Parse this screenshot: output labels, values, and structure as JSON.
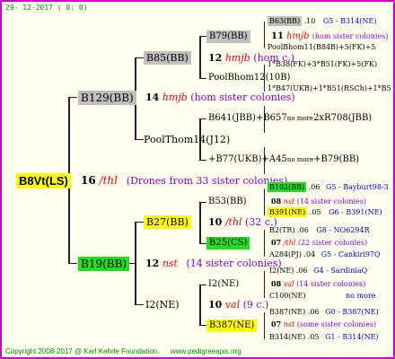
{
  "header": {
    "date": "29- 12-2017 (  0:  0)"
  },
  "footer": {
    "copyright": "Copyright 2008-2017 @ Karl Kehrle Foundation.",
    "site": "www.pedigreeapis.org"
  },
  "root": {
    "name": "B8Vt(LS)",
    "year": "16",
    "mark": "/thl",
    "info": "(Drones from 33 sister colonies)"
  },
  "gen2": {
    "upper": {
      "name": "B129(BB)",
      "year": "14",
      "mark": "hmjb",
      "info": "(hom sister colonies)"
    },
    "lower": {
      "name": "B19(BB)",
      "year": "12",
      "mark": "nst",
      "info": "(14 sister colonies)"
    }
  },
  "gen3": [
    {
      "name": "B85(BB)",
      "year": "12",
      "mark": "hmjb",
      "info": "(hom c.)"
    },
    {
      "name": "PoolThom14(J12)"
    },
    {
      "name": "B27(BB)",
      "year": "10",
      "mark": "/thl",
      "info": "(32 c.)"
    },
    {
      "name": "I2(NE)",
      "year": "10",
      "mark": "val",
      "info": "(9 c.)"
    }
  ],
  "gen4": [
    {
      "name": "B79(BB)",
      "year": "11",
      "mark": "hmjb",
      "info": "(hom sister colonies)"
    },
    {
      "name": "PoolBhom12(10B)"
    },
    {
      "name": "B641(JBB)+B657",
      "mid": "no more",
      "tail": "2xR708(JBB)"
    },
    {
      "name": "+B77(UKB)+A45",
      "mid": "no more",
      "tail": "+B79(BB)"
    },
    {
      "name": "B53(BB)"
    },
    {
      "name": "B25(CS)"
    },
    {
      "name": "I2(NE)"
    },
    {
      "name": "B387(NE)"
    }
  ],
  "gen5": [
    {
      "name": "B63(BB)",
      "num": ".10",
      "link": "G5 - B314(NE)"
    },
    {
      "name": "PoolBhom11(B84B)+5(FK)+5"
    },
    {
      "name": "1*B38(FK)+3*B51(FK)+5(FK)"
    },
    {
      "name": "1*B47(UKB)+1*B51(RSCh)+1*B5"
    },
    {
      "name": "B102(BB)",
      "num": ".06",
      "link": "G5 - Bayburt98-3"
    },
    {
      "year": "08",
      "mark": "nst",
      "info": "(14 sister colonies)"
    },
    {
      "name": "B391(NE)",
      "num": ".05",
      "link": "G6 - B391(NE)"
    },
    {
      "name": "B2(TR)",
      "num": ".06",
      "link": "G8 - NO6294R"
    },
    {
      "year": "07",
      "mark": "/thl",
      "info": "(22 sister colonies)"
    },
    {
      "name": "A284(PJ)",
      "num": ".04",
      "link": "G5 - Cankiri97Q"
    },
    {
      "name": "I2(NE)",
      "num": ".06",
      "link": "G4 - SardiniaQ"
    },
    {
      "year": "08",
      "mark": "val",
      "info": "(14 sister colonies)"
    },
    {
      "name": "C100(NE)",
      "link": "no more"
    },
    {
      "name": "B387(NE)",
      "num": ".06",
      "link": "G0 - B387(NE)"
    },
    {
      "year": "07",
      "mark": "nst",
      "info": "(some sister colonies)"
    },
    {
      "name": "B314(NE)",
      "num": ".05",
      "link": "G1 - B314(NE)"
    }
  ],
  "colors": {
    "border": "#cc00cc",
    "background": "#fffff0",
    "highlight_yellow": "#ffff00",
    "highlight_green": "#22dd22",
    "highlight_gray": "#c0c0c0",
    "mark_red": "#ff0000",
    "info_purple": "#8800cc",
    "link_blue": "#0000cc"
  }
}
